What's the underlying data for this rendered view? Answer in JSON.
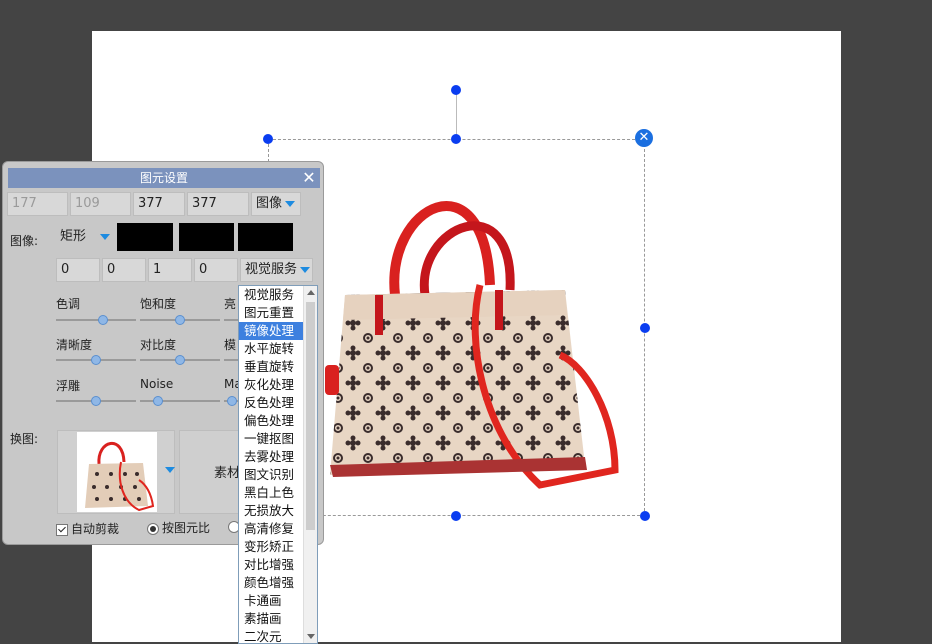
{
  "panel": {
    "title": "图元设置",
    "close_glyph": "✕",
    "geometry_fields": [
      "177",
      "109",
      "377",
      "377"
    ],
    "image_mode": "图像",
    "image_label": "图像:",
    "shape": "矩形",
    "effect_fields": [
      "0",
      "0",
      "1",
      "0"
    ],
    "effect_select": "视觉服务",
    "sliders": [
      {
        "label": "色调",
        "value": 0.5
      },
      {
        "label": "饱和度",
        "value": 0.5
      },
      {
        "label": "亮",
        "value": 0.5
      },
      {
        "label": "清晰度",
        "value": 0.5
      },
      {
        "label": "对比度",
        "value": 0.5
      },
      {
        "label": "模",
        "value": 0.5
      },
      {
        "label": "浮雕",
        "value": 0.5
      },
      {
        "label": "Noise",
        "value": 0.2
      },
      {
        "label": "Ma",
        "value": 0.1
      }
    ],
    "replace_label": "换图:",
    "material_label": "素材",
    "auto_crop_label": "自动剪裁",
    "by_ratio_label": "按图元比"
  },
  "dropdown": {
    "items": [
      "视觉服务",
      "图元重置",
      "镜像处理",
      "水平旋转",
      "垂直旋转",
      "灰化处理",
      "反色处理",
      "偏色处理",
      "一键抠图",
      "去雾处理",
      "图文识别",
      "黑白上色",
      "无损放大",
      "高清修复",
      "变形矫正",
      "对比增强",
      "颜色增强",
      "卡通画",
      "素描画",
      "二次元"
    ],
    "selected_index": 2
  },
  "canvas": {
    "close_glyph": "✕"
  },
  "colors": {
    "accent": "#3d80df",
    "handle": "#0a3df0",
    "title_bar": "#7b92bd"
  }
}
